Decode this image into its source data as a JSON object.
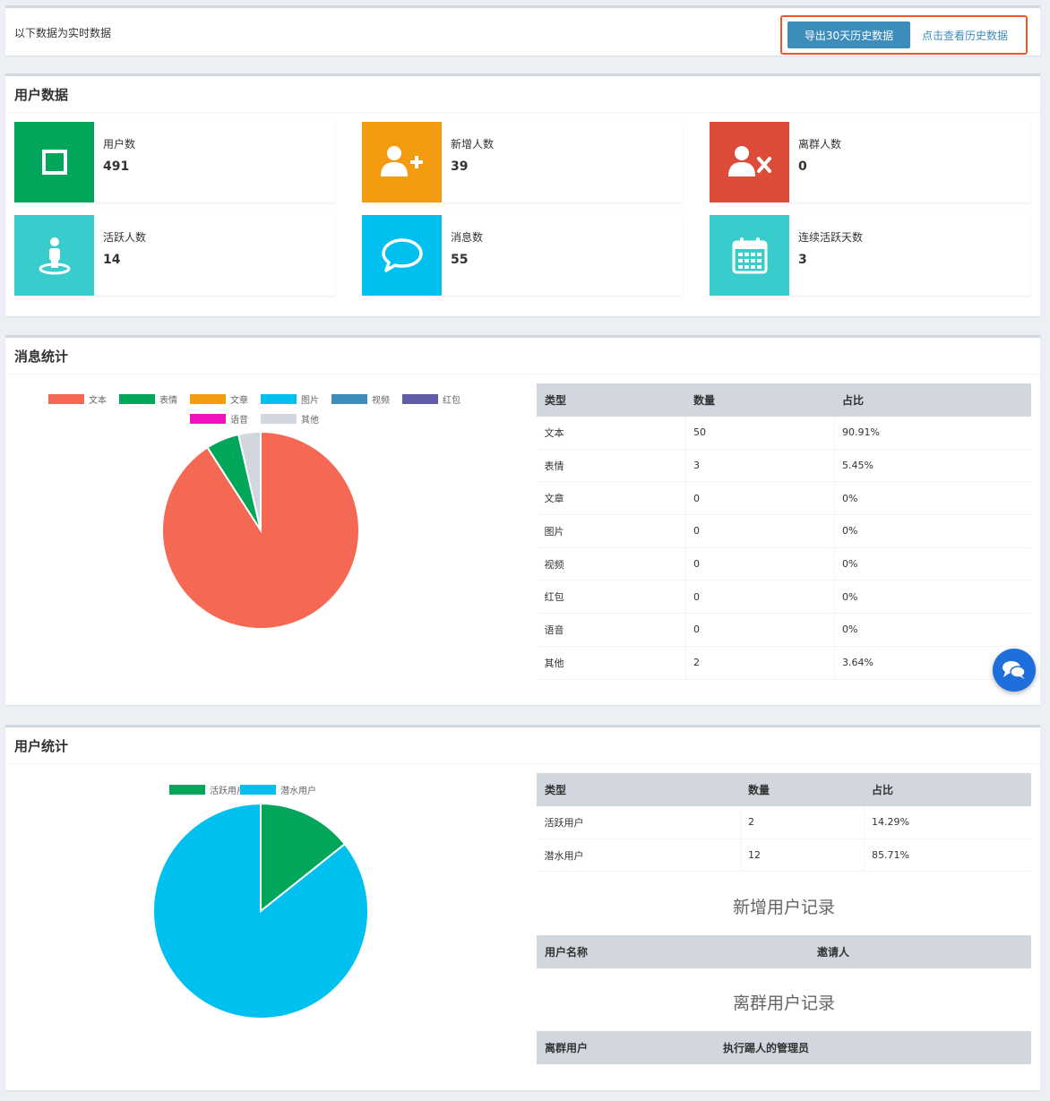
{
  "topbar": {
    "realtime_text": "以下数据为实时数据",
    "export_label": "导出30天历史数据",
    "view_history_label": "点击查看历史数据"
  },
  "user_data": {
    "title": "用户数据",
    "cards": [
      {
        "label": "用户数",
        "value": "491",
        "color": "#00a65a",
        "icon": "square-icon"
      },
      {
        "label": "新增人数",
        "value": "39",
        "color": "#f39c12",
        "icon": "user-plus-icon"
      },
      {
        "label": "离群人数",
        "value": "0",
        "color": "#dd4b39",
        "icon": "user-times-icon"
      },
      {
        "label": "活跃人数",
        "value": "14",
        "color": "#39cccc",
        "icon": "street-view-icon"
      },
      {
        "label": "消息数",
        "value": "55",
        "color": "#00c0ef",
        "icon": "comment-icon"
      },
      {
        "label": "连续活跃天数",
        "value": "3",
        "color": "#39cccc",
        "icon": "calendar-icon"
      }
    ]
  },
  "message_stats": {
    "title": "消息统计",
    "table": {
      "headers": [
        "类型",
        "数量",
        "占比"
      ],
      "rows": [
        [
          "文本",
          "50",
          "90.91%"
        ],
        [
          "表情",
          "3",
          "5.45%"
        ],
        [
          "文章",
          "0",
          "0%"
        ],
        [
          "图片",
          "0",
          "0%"
        ],
        [
          "视频",
          "0",
          "0%"
        ],
        [
          "红包",
          "0",
          "0%"
        ],
        [
          "语音",
          "0",
          "0%"
        ],
        [
          "其他",
          "2",
          "3.64%"
        ]
      ]
    }
  },
  "user_stats": {
    "title": "用户统计",
    "table": {
      "headers": [
        "类型",
        "数量",
        "占比"
      ],
      "rows": [
        [
          "活跃用户",
          "2",
          "14.29%"
        ],
        [
          "潜水用户",
          "12",
          "85.71%"
        ]
      ]
    },
    "new_records_title": "新增用户记录",
    "new_records_headers": [
      "用户名称",
      "邀请人"
    ],
    "left_records_title": "离群用户记录",
    "left_records_headers": [
      "离群用户",
      "执行踢人的管理员"
    ]
  },
  "chart_data": [
    {
      "type": "pie",
      "categories": [
        "文本",
        "表情",
        "文章",
        "图片",
        "视频",
        "红包",
        "语音",
        "其他"
      ],
      "values": [
        50,
        3,
        0,
        0,
        0,
        0,
        0,
        2
      ],
      "colors": [
        "#f56954",
        "#00a65a",
        "#f39c12",
        "#00c0ef",
        "#3c8dbc",
        "#605ca8",
        "#f012be",
        "#d2d6de"
      ],
      "legend": "top"
    },
    {
      "type": "pie",
      "categories": [
        "活跃用户",
        "潜水用户"
      ],
      "values": [
        2,
        12
      ],
      "colors": [
        "#00a65a",
        "#00c0ef"
      ],
      "legend": "top"
    }
  ],
  "chat_fab_icon": "chat-bubbles-icon"
}
